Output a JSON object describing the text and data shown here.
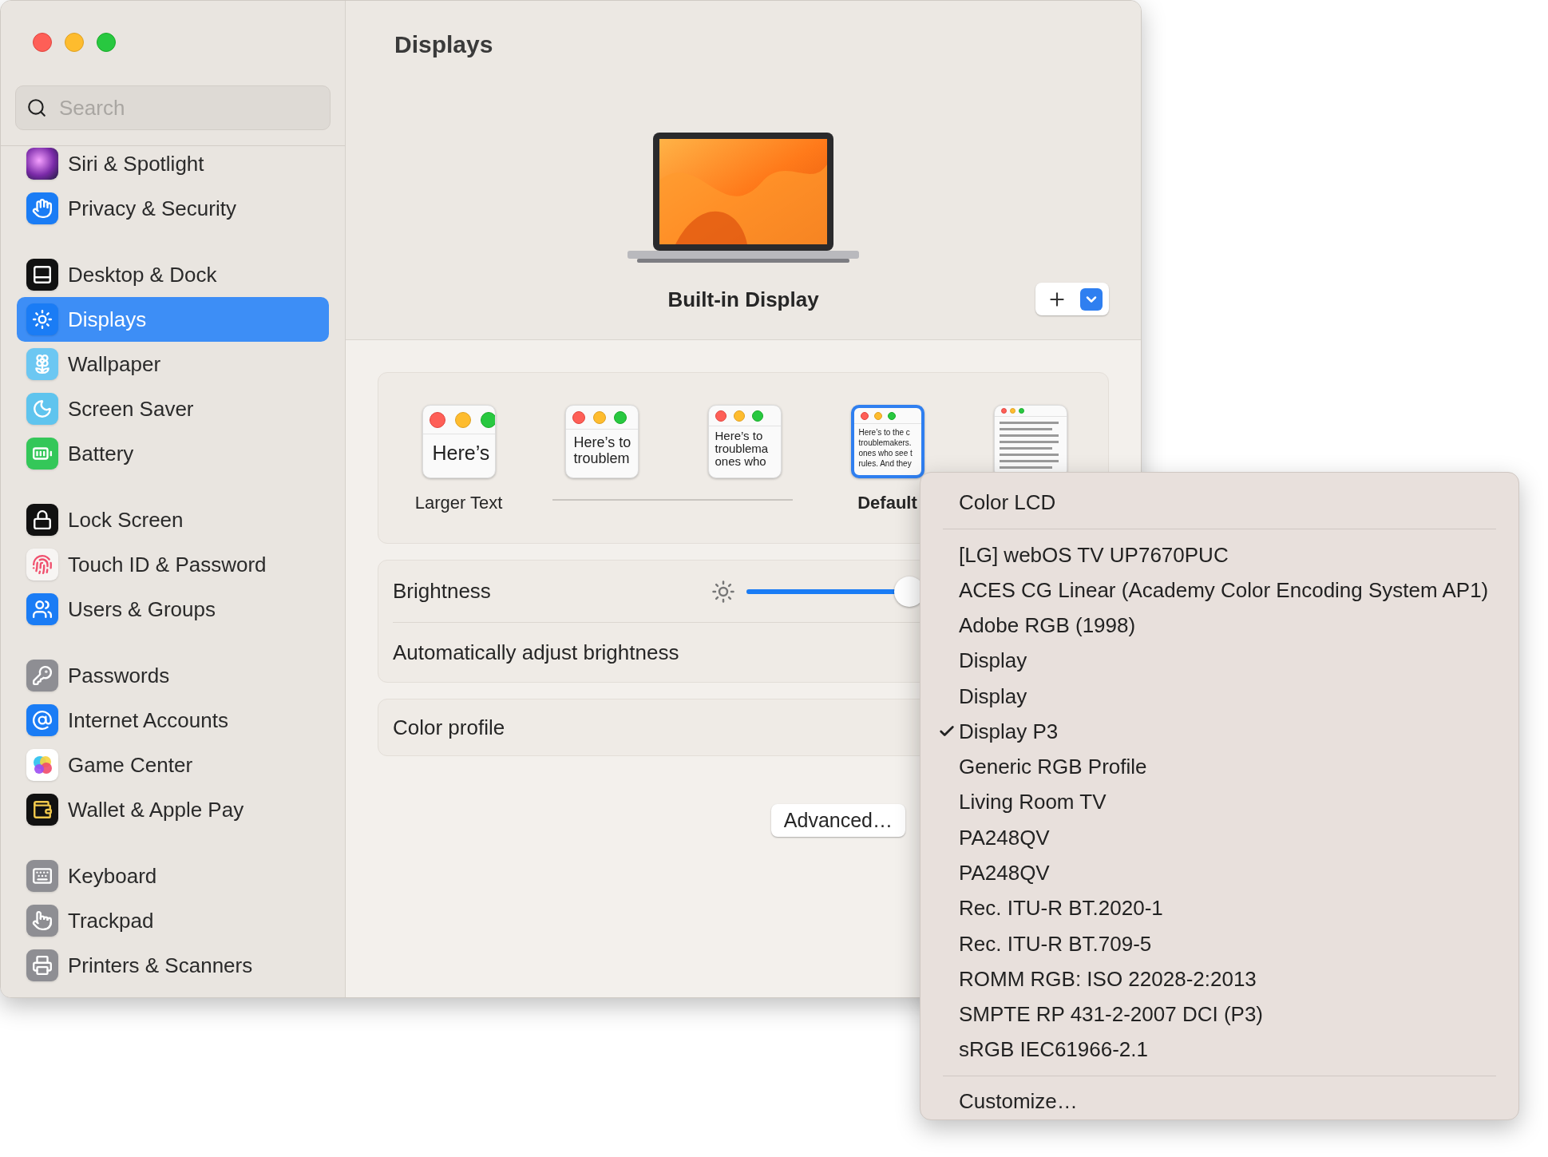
{
  "window": {
    "title": "Displays"
  },
  "sidebar": {
    "search": {
      "placeholder": "Search"
    },
    "groups": [
      [
        {
          "label": "Siri & Spotlight",
          "selected": false
        },
        {
          "label": "Privacy & Security",
          "selected": false
        }
      ],
      [
        {
          "label": "Desktop & Dock",
          "selected": false
        },
        {
          "label": "Displays",
          "selected": true
        },
        {
          "label": "Wallpaper",
          "selected": false
        },
        {
          "label": "Screen Saver",
          "selected": false
        },
        {
          "label": "Battery",
          "selected": false
        }
      ],
      [
        {
          "label": "Lock Screen",
          "selected": false
        },
        {
          "label": "Touch ID & Password",
          "selected": false
        },
        {
          "label": "Users & Groups",
          "selected": false
        }
      ],
      [
        {
          "label": "Passwords",
          "selected": false
        },
        {
          "label": "Internet Accounts",
          "selected": false
        },
        {
          "label": "Game Center",
          "selected": false
        },
        {
          "label": "Wallet & Apple Pay",
          "selected": false
        }
      ],
      [
        {
          "label": "Keyboard",
          "selected": false
        },
        {
          "label": "Trackpad",
          "selected": false
        },
        {
          "label": "Printers & Scanners",
          "selected": false
        }
      ]
    ]
  },
  "display": {
    "name": "Built-in Display"
  },
  "text_size": {
    "options": [
      {
        "kind": "large",
        "lines": [
          "Here’s"
        ],
        "label": "Larger Text",
        "selected": false
      },
      {
        "kind": "medium",
        "lines": [
          "Here’s to",
          "troublem"
        ],
        "selected": false
      },
      {
        "kind": "small",
        "lines": [
          "Here’s to",
          "troublema",
          "ones who"
        ],
        "selected": false
      },
      {
        "kind": "tiny",
        "lines": [
          "Here’s to the c",
          "troublemakers.",
          "ones who see t",
          "rules. And they"
        ],
        "label": "Default",
        "selected": true
      },
      {
        "kind": "dense",
        "selected": false
      }
    ]
  },
  "brightness": {
    "label": "Brightness",
    "level": 0.47
  },
  "auto_brightness": {
    "label": "Automatically adjust brightness"
  },
  "color_profile": {
    "label": "Color profile"
  },
  "advanced_button": "Advanced…",
  "menu": {
    "header": "Color LCD",
    "items": [
      {
        "label": "[LG] webOS TV UP7670PUC",
        "checked": false
      },
      {
        "label": "ACES CG Linear (Academy Color Encoding System AP1)",
        "checked": false
      },
      {
        "label": "Adobe RGB (1998)",
        "checked": false
      },
      {
        "label": "Display",
        "checked": false
      },
      {
        "label": "Display",
        "checked": false
      },
      {
        "label": "Display P3",
        "checked": true
      },
      {
        "label": "Generic RGB Profile",
        "checked": false
      },
      {
        "label": "Living Room TV",
        "checked": false
      },
      {
        "label": "PA248QV",
        "checked": false
      },
      {
        "label": "PA248QV",
        "checked": false
      },
      {
        "label": "Rec. ITU-R BT.2020-1",
        "checked": false
      },
      {
        "label": "Rec. ITU-R BT.709-5",
        "checked": false
      },
      {
        "label": "ROMM RGB: ISO 22028-2:2013",
        "checked": false
      },
      {
        "label": "SMPTE RP 431-2-2007 DCI (P3)",
        "checked": false
      },
      {
        "label": "sRGB IEC61966-2.1",
        "checked": false
      }
    ],
    "footer": "Customize…"
  }
}
